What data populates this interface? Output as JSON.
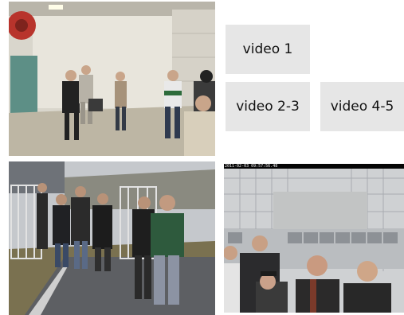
{
  "buttons": {
    "video_1": "video 1",
    "video_2_3": "video 2-3",
    "video_4_5": "video 4-5"
  },
  "thumbnails": {
    "timestamp": "2011-02-03 09:57:56.48"
  }
}
